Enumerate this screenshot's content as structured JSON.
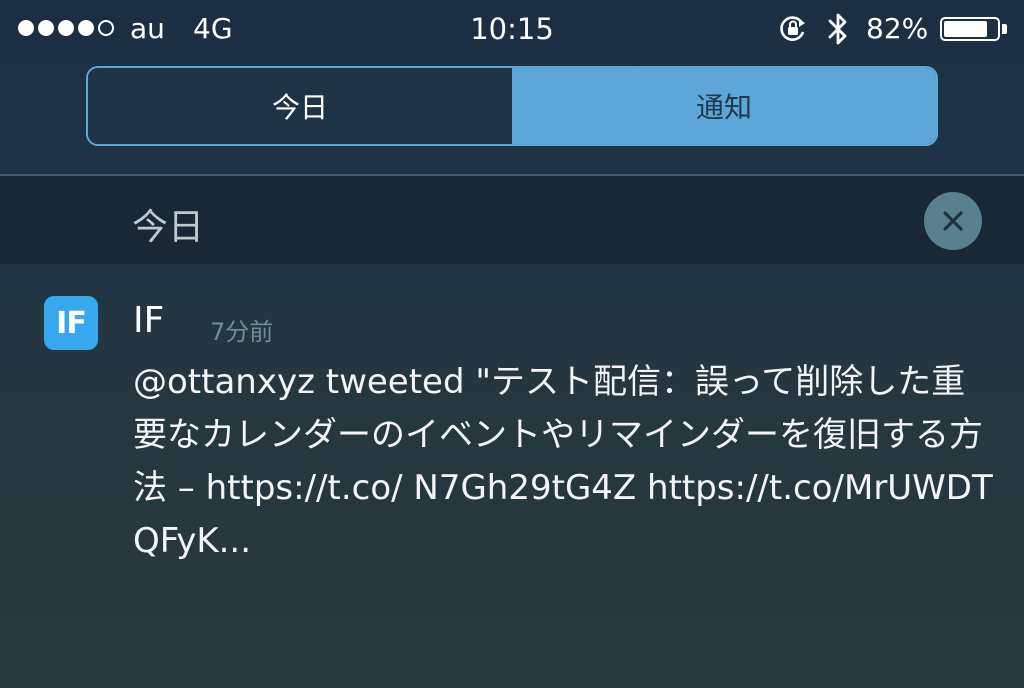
{
  "status_bar": {
    "signal_bars_filled": 4,
    "signal_bars_total": 5,
    "carrier": "au",
    "network": "4G",
    "time": "10:15",
    "orientation_lock_icon": "orientation-lock-icon",
    "bluetooth_icon": "bluetooth-icon",
    "battery_percent_label": "82%",
    "battery_level": 0.82
  },
  "segmented_control": {
    "tabs": [
      {
        "label": "今日",
        "selected": true
      },
      {
        "label": "通知",
        "selected": false
      }
    ]
  },
  "section": {
    "title": "今日",
    "clear_icon": "close-icon"
  },
  "notification": {
    "app_icon_text": "IF",
    "app_name": "IF",
    "timestamp": "7分前",
    "message": "@ottanxyz tweeted \"テスト配信：誤って削除した重要なカレンダーのイベントやリマインダーを復旧する方法 – https://t.co/ N7Gh29tG4Z https://t.co/MrUWDTQFyK..."
  },
  "colors": {
    "accent": "#5ca6d8",
    "background": "#203447",
    "app_icon": "#37a7ee",
    "timestamp": "#6f8e95",
    "clear_button": "#58808e"
  }
}
